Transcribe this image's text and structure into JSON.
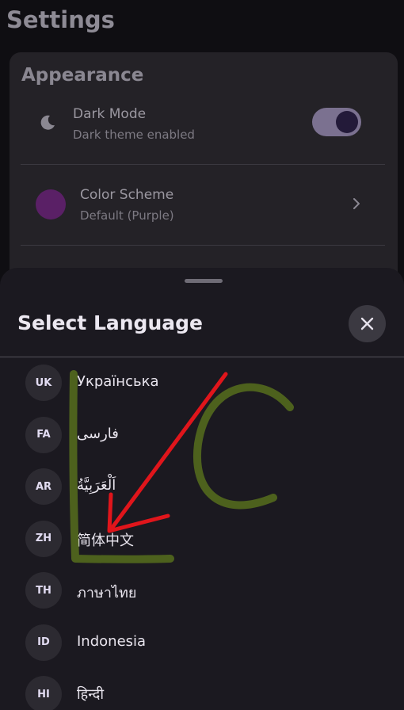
{
  "settings": {
    "title": "Settings",
    "appearance": {
      "section_title": "Appearance",
      "dark_mode": {
        "title": "Dark Mode",
        "subtitle": "Dark theme enabled",
        "enabled": true,
        "icon": "moon-icon"
      },
      "color_scheme": {
        "title": "Color Scheme",
        "subtitle": "Default (Purple)",
        "swatch_color": "#5a2066",
        "icon": "chevron-right-icon"
      }
    }
  },
  "sheet": {
    "title": "Select Language",
    "close_icon": "close-icon",
    "languages": [
      {
        "code": "UK",
        "name": "Українська"
      },
      {
        "code": "FA",
        "name": "فارسی"
      },
      {
        "code": "AR",
        "name": "اَلْعَرَبِيَّةُ"
      },
      {
        "code": "ZH",
        "name": "简体中文"
      },
      {
        "code": "TH",
        "name": "ภาษาไทย"
      },
      {
        "code": "ID",
        "name": "Indonesia"
      },
      {
        "code": "HI",
        "name": "हिन्दी"
      }
    ]
  },
  "annotation": {
    "drawn_letters": "LC",
    "letters_color": "#5f7a1c",
    "arrow_color": "#e0151b"
  }
}
